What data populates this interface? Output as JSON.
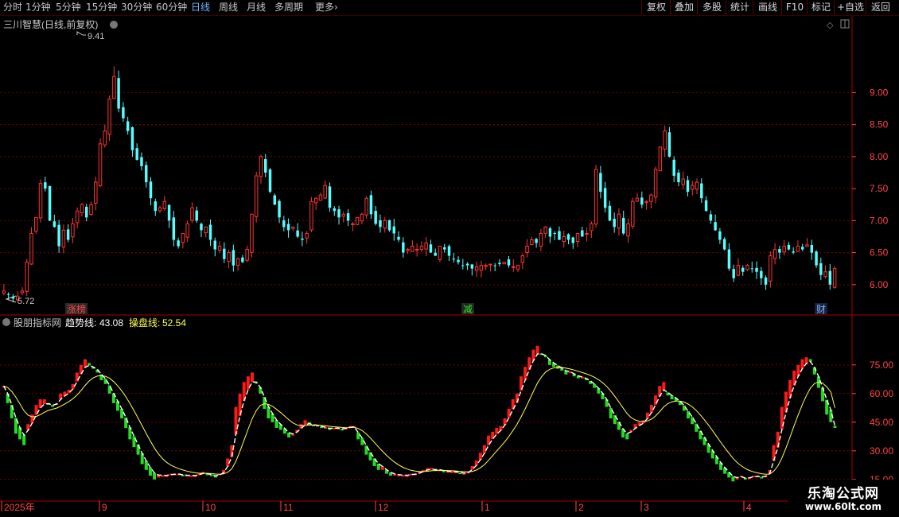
{
  "toolbar": {
    "periods": [
      "分时",
      "1分钟",
      "5分钟",
      "15分钟",
      "30分钟",
      "60分钟",
      "日线",
      "周线",
      "月线",
      "多周期",
      "更多"
    ],
    "active_period": "日线",
    "buttons": [
      "复权",
      "叠加",
      "多股",
      "统计",
      "画线",
      "F10",
      "标记",
      "+自选",
      "返回"
    ]
  },
  "main_panel": {
    "title": "三川智慧(日线,前复权)",
    "high_label": "9.41",
    "low_label": "5.72",
    "events": [
      "涨榜",
      "减",
      "财"
    ]
  },
  "indicator_panel": {
    "name": "股朋指标网",
    "trend_label": "趋势线:",
    "trend_value": "43.08",
    "op_label": "操盘线:",
    "op_value": "52.54"
  },
  "x_axis_labels": [
    "2025年",
    "9",
    "10",
    "11",
    "12",
    "1",
    "2",
    "3",
    "4"
  ],
  "watermark": {
    "line1": "乐淘公式网",
    "line2": "www.60lt.com"
  },
  "colors": {
    "up": "#ff3333",
    "down": "#54ffff",
    "bar_up": "#ff1a1a",
    "bar_down": "#22dd22",
    "trend": "#ffffff",
    "op": "#ffff55",
    "axis": "#ff4444",
    "grid": "#7a0000"
  },
  "chart_data": [
    {
      "type": "candlestick",
      "title": "三川智慧(日线,前复权)",
      "ylim": [
        5.6,
        9.95
      ],
      "yticks": [
        6.0,
        6.5,
        7.0,
        7.5,
        8.0,
        8.5,
        9.0
      ],
      "max": 9.41,
      "min": 5.72,
      "x_labels": [
        "2025年",
        "9",
        "10",
        "11",
        "12",
        "1",
        "2",
        "3",
        "4"
      ],
      "closes": [
        5.9,
        5.85,
        5.78,
        5.82,
        5.9,
        6.35,
        6.8,
        7.05,
        7.58,
        7.5,
        7.0,
        6.9,
        6.6,
        6.85,
        6.7,
        6.95,
        7.15,
        7.25,
        7.05,
        7.25,
        7.6,
        8.2,
        8.4,
        8.9,
        9.25,
        8.75,
        8.6,
        8.4,
        8.1,
        7.95,
        7.85,
        7.6,
        7.35,
        7.15,
        7.2,
        7.3,
        7.0,
        6.7,
        6.6,
        6.8,
        6.95,
        7.2,
        7.0,
        6.85,
        6.9,
        6.7,
        6.55,
        6.6,
        6.4,
        6.5,
        6.3,
        6.4,
        6.35,
        6.55,
        7.1,
        7.7,
        8.0,
        7.75,
        7.45,
        7.25,
        7.05,
        6.9,
        6.85,
        6.9,
        6.75,
        6.7,
        6.8,
        7.3,
        7.35,
        7.4,
        7.55,
        7.2,
        7.15,
        7.05,
        7.1,
        7.0,
        6.95,
        7.05,
        7.1,
        7.35,
        7.1,
        6.95,
        6.9,
        7.0,
        6.85,
        6.8,
        6.7,
        6.5,
        6.55,
        6.6,
        6.55,
        6.6,
        6.65,
        6.5,
        6.45,
        6.6,
        6.55,
        6.45,
        6.4,
        6.35,
        6.3,
        6.3,
        6.25,
        6.28,
        6.3,
        6.3,
        6.32,
        6.3,
        6.32,
        6.35,
        6.3,
        6.28,
        6.3,
        6.45,
        6.6,
        6.7,
        6.65,
        6.8,
        6.9,
        6.75,
        6.8,
        6.7,
        6.75,
        6.7,
        6.65,
        6.8,
        6.75,
        6.8,
        6.95,
        7.8,
        7.45,
        7.2,
        7.0,
        6.9,
        7.1,
        6.8,
        6.95,
        7.3,
        7.35,
        7.25,
        7.3,
        7.4,
        7.8,
        8.15,
        8.4,
        8.0,
        7.7,
        7.6,
        7.65,
        7.45,
        7.55,
        7.6,
        7.35,
        7.15,
        7.0,
        6.85,
        6.7,
        6.55,
        6.25,
        6.1,
        6.3,
        6.2,
        6.3,
        6.25,
        6.2,
        6.1,
        6.0,
        6.45,
        6.55,
        6.5,
        6.6,
        6.55,
        6.5,
        6.6,
        6.55,
        6.62,
        6.5,
        6.3,
        6.15,
        6.2,
        6.0,
        6.25
      ]
    },
    {
      "type": "bar",
      "title": "股朋指标网",
      "ylim": [
        12,
        92
      ],
      "yticks": [
        15.0,
        30.0,
        45.0,
        60.0,
        75.0
      ],
      "series": [
        {
          "name": "趋势线",
          "last": 43.08
        },
        {
          "name": "操盘线",
          "last": 52.54
        }
      ],
      "values": [
        64.0,
        55.0,
        47.0,
        39.0,
        36.0,
        33.0,
        44.0,
        49.0,
        54.0,
        57.0,
        57.0,
        55.0,
        53.0,
        55.0,
        60.0,
        61.0,
        62.0,
        65.0,
        71.0,
        75.0,
        78.0,
        76.0,
        73.0,
        71.0,
        67.0,
        65.0,
        60.0,
        55.0,
        51.0,
        47.0,
        42.0,
        36.0,
        32.0,
        28.0,
        23.0,
        20.0,
        17.0,
        15.0,
        16.0,
        17.0,
        17.0,
        18.0,
        18.0,
        18.0,
        17.0,
        17.0,
        17.0,
        17.0,
        18.0,
        19.0,
        18.0,
        17.0,
        16.0,
        18.0,
        20.0,
        26.0,
        33.0,
        53.0,
        60.0,
        66.0,
        69.0,
        71.0,
        66.0,
        60.0,
        52.0,
        47.0,
        45.0,
        42.0,
        41.0,
        39.0,
        37.0,
        38.0,
        41.0,
        44.0,
        46.0,
        45.0,
        43.0,
        43.0,
        42.0,
        42.0,
        41.0,
        42.0,
        42.0,
        41.0,
        42.0,
        43.0,
        43.0,
        36.0,
        33.0,
        28.0,
        25.0,
        22.0,
        20.0,
        20.0,
        18.0,
        17.0,
        17.0,
        17.0,
        17.0,
        17.0,
        18.0,
        18.0,
        19.0,
        20.0,
        21.0,
        21.0,
        20.0,
        20.0,
        19.0,
        19.0,
        19.0,
        19.0,
        18.0,
        18.0,
        19.0,
        22.0,
        25.0,
        29.0,
        33.0,
        38.0,
        40.0,
        42.0,
        43.0,
        47.0,
        52.0,
        57.0,
        60.0,
        69.0,
        74.0,
        79.0,
        83.0,
        85.0,
        81.0,
        79.0,
        75.0,
        74.0,
        73.0,
        72.0,
        70.0,
        71.0,
        69.0,
        68.0,
        68.0,
        67.0,
        65.0,
        63.0,
        60.0,
        57.0,
        53.0,
        47.0,
        44.0,
        41.0,
        37.0,
        36.0,
        41.0,
        44.0,
        45.0,
        46.0,
        50.0,
        54.0,
        59.0,
        64.0,
        66.0,
        59.0,
        57.0,
        56.0,
        54.0,
        51.0,
        47.0,
        44.0,
        40.0,
        36.0,
        33.0,
        29.0,
        26.0,
        23.0,
        20.0,
        18.0,
        16.0,
        14.0,
        15.0,
        17.0,
        15.0,
        16.0,
        17.0,
        17.0,
        16.0,
        17.0,
        20.0,
        33.0,
        40.0,
        53.0,
        61.0,
        67.0,
        72.0,
        75.0,
        78.0,
        79.0,
        78.0,
        70.0,
        63.0,
        56.0,
        49.0,
        45.0,
        42.0
      ]
    }
  ]
}
